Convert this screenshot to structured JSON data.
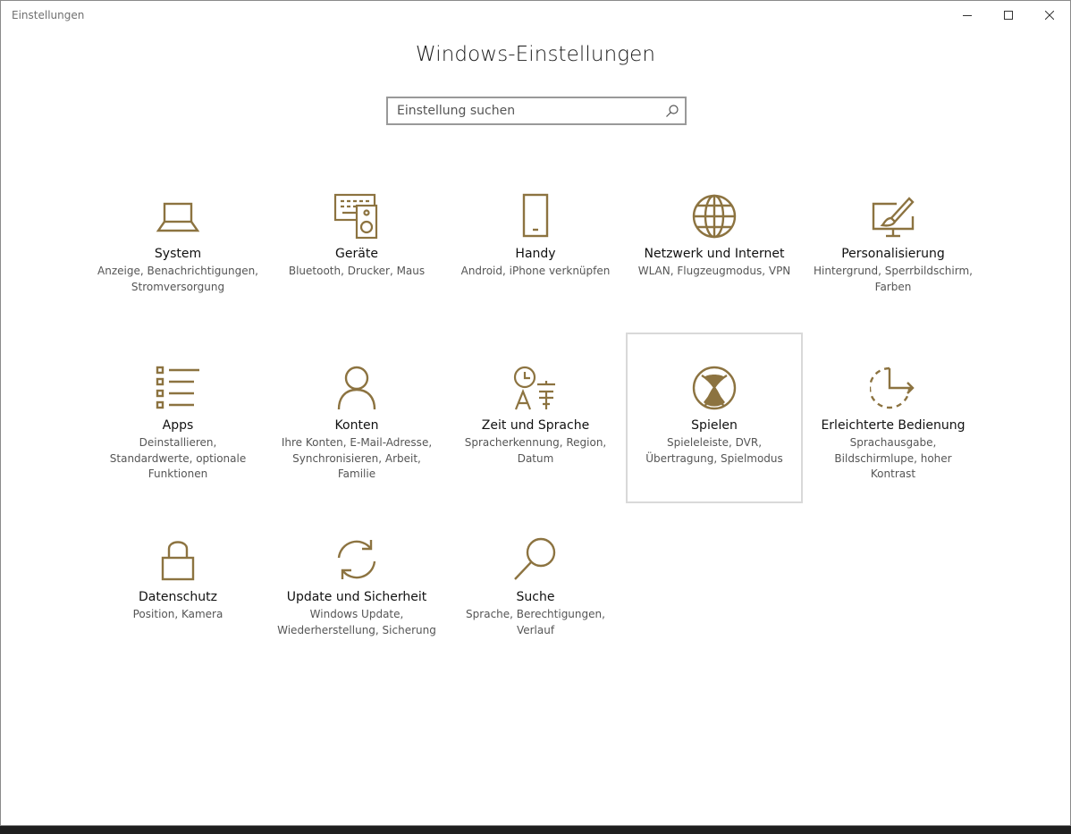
{
  "window": {
    "title": "Einstellungen",
    "accent_color": "#8c7340"
  },
  "header": {
    "title": "Windows-Einstellungen"
  },
  "search": {
    "placeholder": "Einstellung suchen"
  },
  "tiles": [
    {
      "label": "System",
      "desc": "Anzeige, Benachrichtigungen, Stromversorgung",
      "icon": "laptop-icon"
    },
    {
      "label": "Geräte",
      "desc": "Bluetooth, Drucker, Maus",
      "icon": "devices-icon"
    },
    {
      "label": "Handy",
      "desc": "Android, iPhone verknüpfen",
      "icon": "phone-icon"
    },
    {
      "label": "Netzwerk und Internet",
      "desc": "WLAN, Flugzeugmodus, VPN",
      "icon": "globe-icon"
    },
    {
      "label": "Personalisierung",
      "desc": "Hintergrund, Sperrbildschirm, Farben",
      "icon": "paint-icon"
    },
    {
      "label": "Apps",
      "desc": "Deinstallieren, Standardwerte, optionale Funktionen",
      "icon": "apps-list-icon"
    },
    {
      "label": "Konten",
      "desc": "Ihre Konten, E-Mail-Adresse, Synchronisieren, Arbeit, Familie",
      "icon": "person-icon"
    },
    {
      "label": "Zeit und Sprache",
      "desc": "Spracherkennung, Region, Datum",
      "icon": "time-language-icon"
    },
    {
      "label": "Spielen",
      "desc": "Spieleleiste, DVR, Übertragung, Spielmodus",
      "icon": "xbox-icon"
    },
    {
      "label": "Erleichterte Bedienung",
      "desc": "Sprachausgabe, Bildschirmlupe, hoher Kontrast",
      "icon": "ease-of-access-icon"
    },
    {
      "label": "Datenschutz",
      "desc": "Position, Kamera",
      "icon": "lock-icon"
    },
    {
      "label": "Update und Sicherheit",
      "desc": "Windows Update, Wiederherstellung, Sicherung",
      "icon": "sync-icon"
    },
    {
      "label": "Suche",
      "desc": "Sprache, Berechtigungen, Verlauf",
      "icon": "magnifier-icon"
    }
  ]
}
